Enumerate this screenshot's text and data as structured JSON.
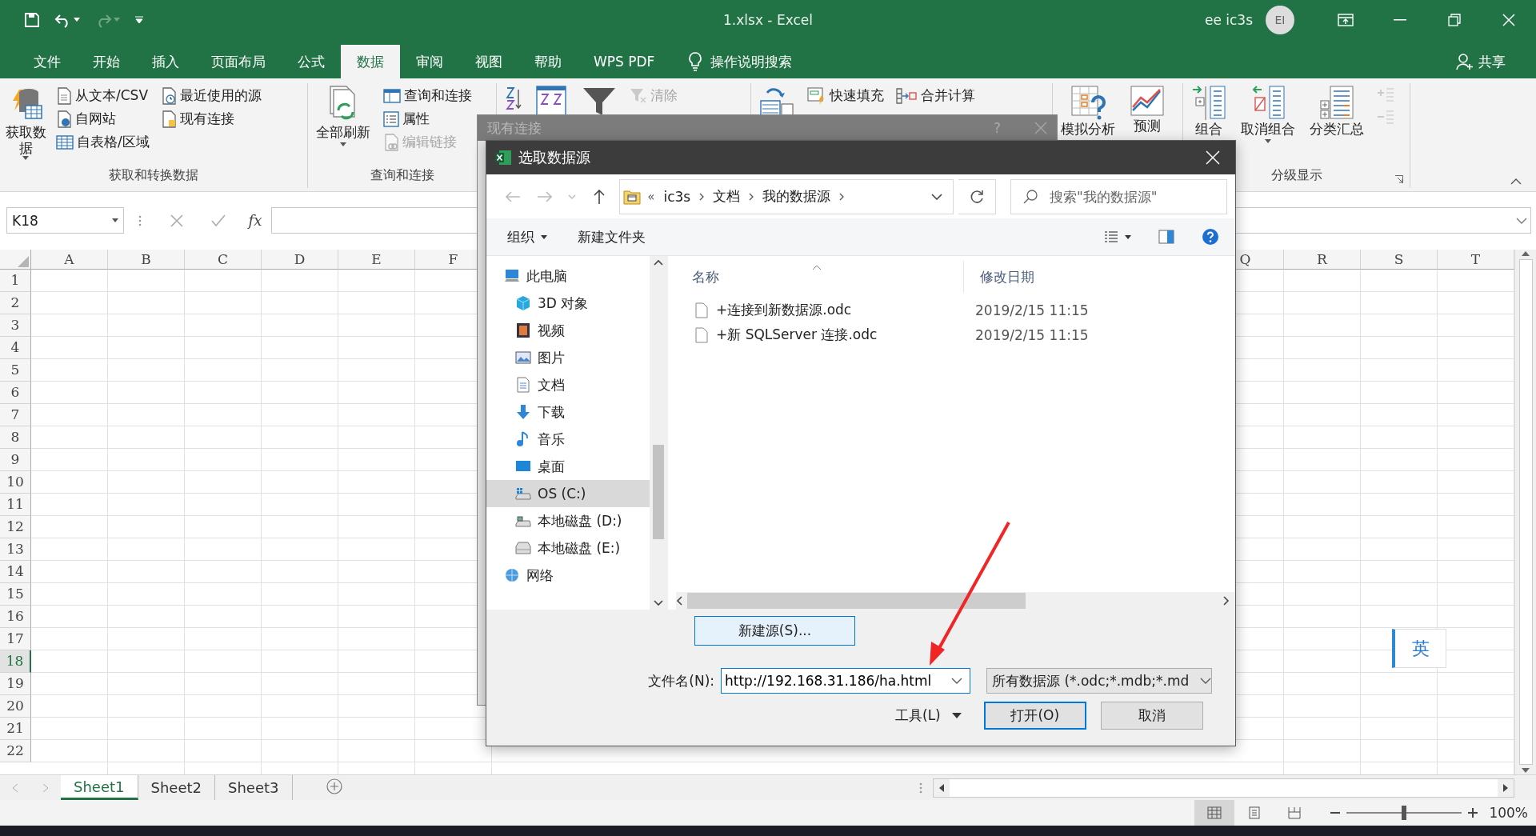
{
  "window": {
    "title": "1.xlsx  -  Excel",
    "user_name": "ee ic3s",
    "avatar_initials": "EI"
  },
  "ribbon_tabs": [
    {
      "label": "文件",
      "selected": false
    },
    {
      "label": "开始",
      "selected": false
    },
    {
      "label": "插入",
      "selected": false
    },
    {
      "label": "页面布局",
      "selected": false
    },
    {
      "label": "公式",
      "selected": false
    },
    {
      "label": "数据",
      "selected": true
    },
    {
      "label": "审阅",
      "selected": false
    },
    {
      "label": "视图",
      "selected": false
    },
    {
      "label": "帮助",
      "selected": false
    },
    {
      "label": "WPS PDF",
      "selected": false
    }
  ],
  "tell_me": "操作说明搜索",
  "share_button": "共享",
  "ribbon_groups": [
    {
      "label": "获取和转换数据",
      "columns": [
        {
          "kind": "large",
          "items": [
            {
              "label": "获取数据",
              "dropdown": true,
              "disabled": false
            }
          ]
        },
        {
          "kind": "small",
          "items": [
            {
              "label": "从文本/CSV",
              "disabled": false
            },
            {
              "label": "自网站",
              "disabled": false
            },
            {
              "label": "自表格/区域",
              "disabled": false
            }
          ]
        },
        {
          "kind": "small",
          "items": [
            {
              "label": "最近使用的源",
              "disabled": false
            },
            {
              "label": "现有连接",
              "disabled": false
            }
          ]
        }
      ]
    },
    {
      "label": "查询和连接",
      "columns": [
        {
          "kind": "large",
          "items": [
            {
              "label": "全部刷新",
              "dropdown": true,
              "disabled": false
            }
          ]
        },
        {
          "kind": "small",
          "items": [
            {
              "label": "查询和连接",
              "disabled": false
            },
            {
              "label": "属性",
              "disabled": false
            },
            {
              "label": "编辑链接",
              "disabled": true
            }
          ]
        }
      ]
    },
    {
      "columns": [
        {
          "kind": "small",
          "items": [
            {
              "disabled": false
            }
          ]
        },
        {
          "kind": "large",
          "items": [
            {
              "dropdown": false,
              "disabled": false
            }
          ]
        },
        {
          "kind": "large",
          "items": [
            {
              "dropdown": false,
              "disabled": false
            }
          ]
        },
        {
          "kind": "small",
          "items": [
            {
              "label": "清除",
              "disabled": true
            }
          ]
        }
      ]
    },
    {
      "columns": [
        {
          "kind": "large",
          "items": [
            {
              "dropdown": false,
              "disabled": false
            }
          ]
        },
        {
          "kind": "small",
          "items": [
            {
              "label": "快速填充",
              "disabled": false
            }
          ]
        },
        {
          "kind": "small",
          "items": [
            {
              "label": "合并计算",
              "disabled": false
            }
          ]
        }
      ]
    },
    {
      "columns": [
        {
          "kind": "large",
          "items": [
            {
              "label": "模拟分析",
              "dropdown": false,
              "disabled": false
            }
          ]
        },
        {
          "kind": "large",
          "items": [
            {
              "label": "预测",
              "dropdown": false,
              "disabled": false
            }
          ]
        }
      ]
    },
    {
      "label": "分级显示",
      "launcher": true,
      "columns": [
        {
          "kind": "large",
          "items": [
            {
              "label": "组合",
              "dropdown": false,
              "disabled": false
            }
          ]
        },
        {
          "kind": "large",
          "items": [
            {
              "label": "取消组合",
              "dropdown": true,
              "disabled": false
            }
          ]
        },
        {
          "kind": "large",
          "items": [
            {
              "label": "分类汇总",
              "dropdown": false,
              "disabled": false
            }
          ]
        },
        {
          "kind": "small",
          "items": [
            {
              "disabled": true
            },
            {
              "disabled": true
            }
          ]
        }
      ]
    }
  ],
  "formula_bar": {
    "name_box": "K18",
    "function_label": "fx"
  },
  "sheet": {
    "columns_left": [
      "A",
      "B",
      "C",
      "D",
      "E",
      "F"
    ],
    "columns_right": [
      "Q",
      "R",
      "S",
      "T"
    ],
    "rows": [
      {
        "label": "1",
        "selected": false
      },
      {
        "label": "2",
        "selected": false
      },
      {
        "label": "3",
        "selected": false
      },
      {
        "label": "4",
        "selected": false
      },
      {
        "label": "5",
        "selected": false
      },
      {
        "label": "6",
        "selected": false
      },
      {
        "label": "7",
        "selected": false
      },
      {
        "label": "8",
        "selected": false
      },
      {
        "label": "9",
        "selected": false
      },
      {
        "label": "10",
        "selected": false
      },
      {
        "label": "11",
        "selected": false
      },
      {
        "label": "12",
        "selected": false
      },
      {
        "label": "13",
        "selected": false
      },
      {
        "label": "14",
        "selected": false
      },
      {
        "label": "15",
        "selected": false
      },
      {
        "label": "16",
        "selected": false
      },
      {
        "label": "17",
        "selected": false
      },
      {
        "label": "18",
        "selected": true
      },
      {
        "label": "19",
        "selected": false
      },
      {
        "label": "20",
        "selected": false
      },
      {
        "label": "21",
        "selected": false
      },
      {
        "label": "22",
        "selected": false
      }
    ]
  },
  "sheet_tabs": [
    {
      "label": "Sheet1",
      "selected": true
    },
    {
      "label": "Sheet2",
      "selected": false
    },
    {
      "label": "Sheet3",
      "selected": false
    }
  ],
  "status_bar": {
    "views": [
      {
        "selected": true
      },
      {
        "selected": false
      },
      {
        "selected": false
      }
    ],
    "zoom": {
      "level": 0.5
    },
    "zoom_label": "100%"
  },
  "back_dialog": {
    "title": "现有连接",
    "help": "?"
  },
  "dialog": {
    "title": "选取数据源",
    "path_overflow": "«",
    "path": [
      "ic3s",
      "文档",
      "我的数据源"
    ],
    "search": {
      "placeholder": "搜索\"我的数据源\""
    },
    "organize": "组织",
    "new_folder": "新建文件夹",
    "nav_tree": [
      {
        "label": "此电脑",
        "selected": false,
        "children": [
          {
            "label": "3D 对象",
            "selected": false
          },
          {
            "label": "视频",
            "selected": false
          },
          {
            "label": "图片",
            "selected": false
          },
          {
            "label": "文档",
            "selected": false
          },
          {
            "label": "下载",
            "selected": false
          },
          {
            "label": "音乐",
            "selected": false
          },
          {
            "label": "桌面",
            "selected": false
          },
          {
            "label": "OS (C:)",
            "selected": true
          },
          {
            "label": "本地磁盘 (D:)",
            "selected": false
          },
          {
            "label": "本地磁盘 (E:)",
            "selected": false
          }
        ]
      },
      {
        "label": "网络",
        "selected": false
      }
    ],
    "file_columns": [
      "名称",
      "修改日期"
    ],
    "files": [
      {
        "name": "+连接到新数据源.odc",
        "modified": "2019/2/15 11:15"
      },
      {
        "name": "+新 SQLServer 连接.odc",
        "modified": "2019/2/15 11:15"
      }
    ],
    "new_source_button": "新建源(S)...",
    "file_name": {
      "label": "文件名(N):",
      "value": "http://192.168.31.186/ha.html"
    },
    "file_type": "所有数据源 (*.odc;*.mdb;*.md",
    "tools": "工具(L)",
    "open_button": "打开(O)",
    "cancel_button": "取消"
  },
  "ime_indicator": "英"
}
